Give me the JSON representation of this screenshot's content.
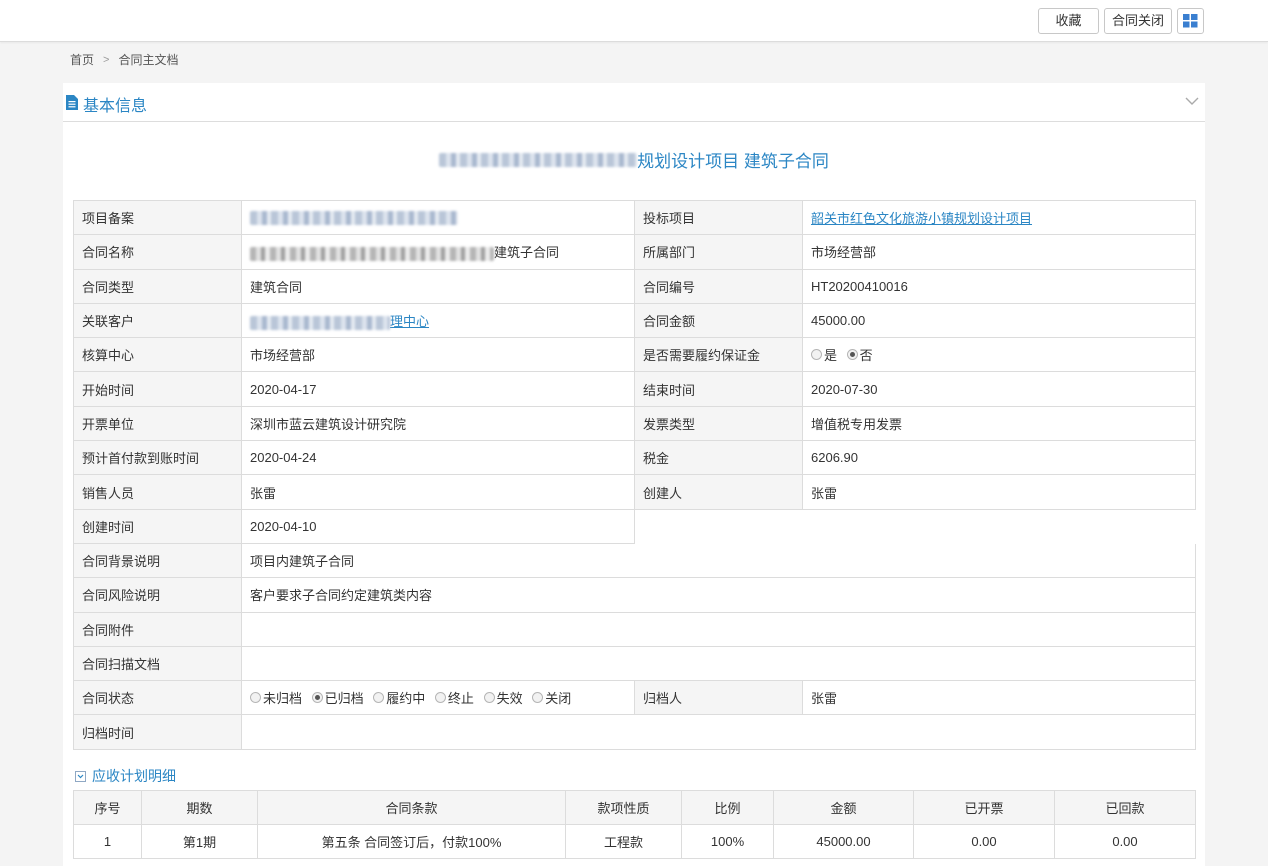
{
  "toolbar": {
    "favorite_label": "收藏",
    "close_contract_label": "合同关闭"
  },
  "breadcrumb": {
    "home": "首页",
    "current": "合同主文档"
  },
  "section": {
    "title": "基本信息"
  },
  "contract_title_visible": "规划设计项目 建筑子合同",
  "fields": {
    "project_record": {
      "label": "项目备案",
      "value": ""
    },
    "bid_project": {
      "label": "投标项目",
      "value": "韶关市红色文化旅游小镇规划设计项目"
    },
    "contract_name": {
      "label": "合同名称",
      "value": "建筑子合同"
    },
    "department": {
      "label": "所属部门",
      "value": "市场经营部"
    },
    "contract_type": {
      "label": "合同类型",
      "value": "建筑合同"
    },
    "contract_no": {
      "label": "合同编号",
      "value": "HT20200410016"
    },
    "customer": {
      "label": "关联客户",
      "value": "理中心"
    },
    "amount": {
      "label": "合同金额",
      "value": "45000.00"
    },
    "accounting_center": {
      "label": "核算中心",
      "value": "市场经营部"
    },
    "performance_bond": {
      "label": "是否需要履约保证金",
      "options": [
        "是",
        "否"
      ],
      "selected": "否"
    },
    "start_date": {
      "label": "开始时间",
      "value": "2020-04-17"
    },
    "end_date": {
      "label": "结束时间",
      "value": "2020-07-30"
    },
    "invoice_unit": {
      "label": "开票单位",
      "value": "深圳市蓝云建筑设计研究院"
    },
    "invoice_type": {
      "label": "发票类型",
      "value": "增值税专用发票"
    },
    "first_payment_date": {
      "label": "预计首付款到账时间",
      "value": "2020-04-24"
    },
    "tax": {
      "label": "税金",
      "value": "6206.90"
    },
    "sales_person": {
      "label": "销售人员",
      "value": "张雷"
    },
    "creator": {
      "label": "创建人",
      "value": "张雷"
    },
    "created_at": {
      "label": "创建时间",
      "value": "2020-04-10"
    },
    "background": {
      "label": "合同背景说明",
      "value": "项目内建筑子合同"
    },
    "risk": {
      "label": "合同风险说明",
      "value": "客户要求子合同约定建筑类内容"
    },
    "attachment": {
      "label": "合同附件",
      "value": ""
    },
    "scan_doc": {
      "label": "合同扫描文档",
      "value": ""
    },
    "status": {
      "label": "合同状态",
      "options": [
        "未归档",
        "已归档",
        "履约中",
        "终止",
        "失效",
        "关闭"
      ],
      "selected": "已归档"
    },
    "archiver": {
      "label": "归档人",
      "value": "张雷"
    },
    "archive_time": {
      "label": "归档时间",
      "value": ""
    }
  },
  "plan": {
    "title": "应收计划明细",
    "columns": [
      "序号",
      "期数",
      "合同条款",
      "款项性质",
      "比例",
      "金额",
      "已开票",
      "已回款"
    ],
    "rows": [
      [
        "1",
        "第1期",
        "第五条 合同签订后，付款100%",
        "工程款",
        "100%",
        "45000.00",
        "0.00",
        "0.00"
      ]
    ]
  },
  "colors": {
    "accent": "#2b86c4",
    "label_bg": "#f5f5f5",
    "border": "#dcdcdc"
  }
}
